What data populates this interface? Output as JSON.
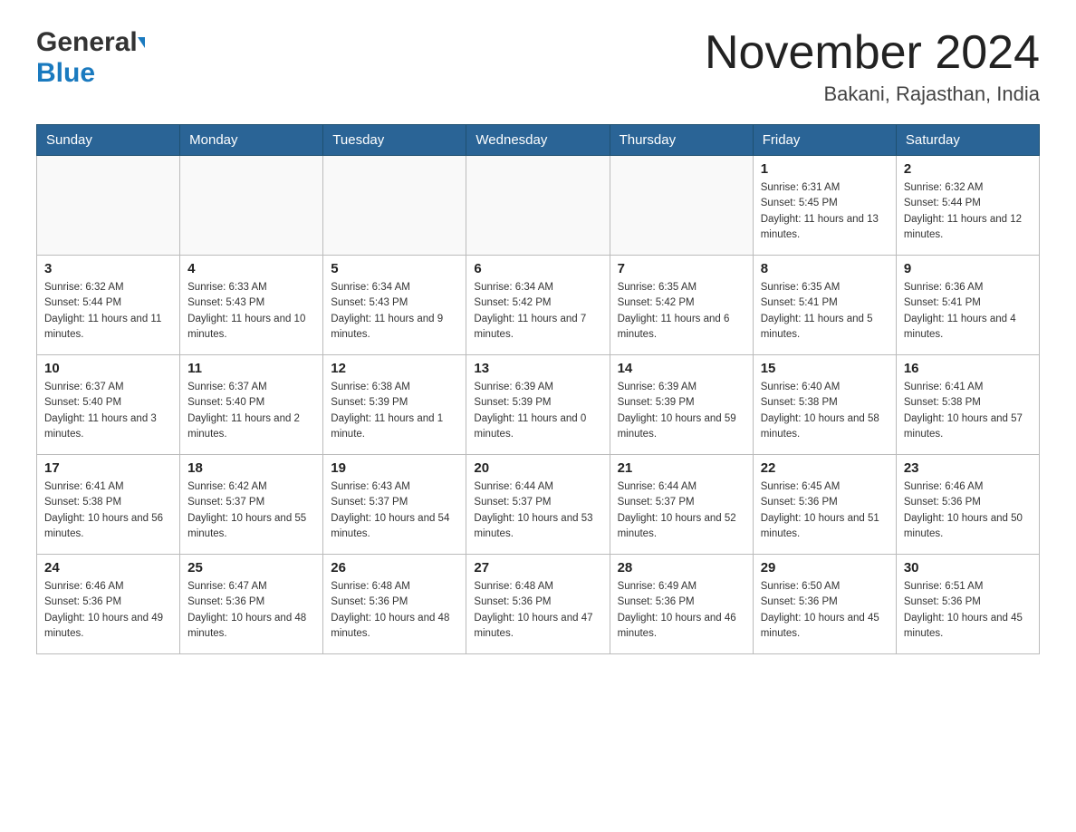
{
  "header": {
    "logo_general": "General",
    "logo_blue": "Blue",
    "month_title": "November 2024",
    "location": "Bakani, Rajasthan, India"
  },
  "weekdays": [
    "Sunday",
    "Monday",
    "Tuesday",
    "Wednesday",
    "Thursday",
    "Friday",
    "Saturday"
  ],
  "weeks": [
    [
      {
        "day": "",
        "sunrise": "",
        "sunset": "",
        "daylight": ""
      },
      {
        "day": "",
        "sunrise": "",
        "sunset": "",
        "daylight": ""
      },
      {
        "day": "",
        "sunrise": "",
        "sunset": "",
        "daylight": ""
      },
      {
        "day": "",
        "sunrise": "",
        "sunset": "",
        "daylight": ""
      },
      {
        "day": "",
        "sunrise": "",
        "sunset": "",
        "daylight": ""
      },
      {
        "day": "1",
        "sunrise": "Sunrise: 6:31 AM",
        "sunset": "Sunset: 5:45 PM",
        "daylight": "Daylight: 11 hours and 13 minutes."
      },
      {
        "day": "2",
        "sunrise": "Sunrise: 6:32 AM",
        "sunset": "Sunset: 5:44 PM",
        "daylight": "Daylight: 11 hours and 12 minutes."
      }
    ],
    [
      {
        "day": "3",
        "sunrise": "Sunrise: 6:32 AM",
        "sunset": "Sunset: 5:44 PM",
        "daylight": "Daylight: 11 hours and 11 minutes."
      },
      {
        "day": "4",
        "sunrise": "Sunrise: 6:33 AM",
        "sunset": "Sunset: 5:43 PM",
        "daylight": "Daylight: 11 hours and 10 minutes."
      },
      {
        "day": "5",
        "sunrise": "Sunrise: 6:34 AM",
        "sunset": "Sunset: 5:43 PM",
        "daylight": "Daylight: 11 hours and 9 minutes."
      },
      {
        "day": "6",
        "sunrise": "Sunrise: 6:34 AM",
        "sunset": "Sunset: 5:42 PM",
        "daylight": "Daylight: 11 hours and 7 minutes."
      },
      {
        "day": "7",
        "sunrise": "Sunrise: 6:35 AM",
        "sunset": "Sunset: 5:42 PM",
        "daylight": "Daylight: 11 hours and 6 minutes."
      },
      {
        "day": "8",
        "sunrise": "Sunrise: 6:35 AM",
        "sunset": "Sunset: 5:41 PM",
        "daylight": "Daylight: 11 hours and 5 minutes."
      },
      {
        "day": "9",
        "sunrise": "Sunrise: 6:36 AM",
        "sunset": "Sunset: 5:41 PM",
        "daylight": "Daylight: 11 hours and 4 minutes."
      }
    ],
    [
      {
        "day": "10",
        "sunrise": "Sunrise: 6:37 AM",
        "sunset": "Sunset: 5:40 PM",
        "daylight": "Daylight: 11 hours and 3 minutes."
      },
      {
        "day": "11",
        "sunrise": "Sunrise: 6:37 AM",
        "sunset": "Sunset: 5:40 PM",
        "daylight": "Daylight: 11 hours and 2 minutes."
      },
      {
        "day": "12",
        "sunrise": "Sunrise: 6:38 AM",
        "sunset": "Sunset: 5:39 PM",
        "daylight": "Daylight: 11 hours and 1 minute."
      },
      {
        "day": "13",
        "sunrise": "Sunrise: 6:39 AM",
        "sunset": "Sunset: 5:39 PM",
        "daylight": "Daylight: 11 hours and 0 minutes."
      },
      {
        "day": "14",
        "sunrise": "Sunrise: 6:39 AM",
        "sunset": "Sunset: 5:39 PM",
        "daylight": "Daylight: 10 hours and 59 minutes."
      },
      {
        "day": "15",
        "sunrise": "Sunrise: 6:40 AM",
        "sunset": "Sunset: 5:38 PM",
        "daylight": "Daylight: 10 hours and 58 minutes."
      },
      {
        "day": "16",
        "sunrise": "Sunrise: 6:41 AM",
        "sunset": "Sunset: 5:38 PM",
        "daylight": "Daylight: 10 hours and 57 minutes."
      }
    ],
    [
      {
        "day": "17",
        "sunrise": "Sunrise: 6:41 AM",
        "sunset": "Sunset: 5:38 PM",
        "daylight": "Daylight: 10 hours and 56 minutes."
      },
      {
        "day": "18",
        "sunrise": "Sunrise: 6:42 AM",
        "sunset": "Sunset: 5:37 PM",
        "daylight": "Daylight: 10 hours and 55 minutes."
      },
      {
        "day": "19",
        "sunrise": "Sunrise: 6:43 AM",
        "sunset": "Sunset: 5:37 PM",
        "daylight": "Daylight: 10 hours and 54 minutes."
      },
      {
        "day": "20",
        "sunrise": "Sunrise: 6:44 AM",
        "sunset": "Sunset: 5:37 PM",
        "daylight": "Daylight: 10 hours and 53 minutes."
      },
      {
        "day": "21",
        "sunrise": "Sunrise: 6:44 AM",
        "sunset": "Sunset: 5:37 PM",
        "daylight": "Daylight: 10 hours and 52 minutes."
      },
      {
        "day": "22",
        "sunrise": "Sunrise: 6:45 AM",
        "sunset": "Sunset: 5:36 PM",
        "daylight": "Daylight: 10 hours and 51 minutes."
      },
      {
        "day": "23",
        "sunrise": "Sunrise: 6:46 AM",
        "sunset": "Sunset: 5:36 PM",
        "daylight": "Daylight: 10 hours and 50 minutes."
      }
    ],
    [
      {
        "day": "24",
        "sunrise": "Sunrise: 6:46 AM",
        "sunset": "Sunset: 5:36 PM",
        "daylight": "Daylight: 10 hours and 49 minutes."
      },
      {
        "day": "25",
        "sunrise": "Sunrise: 6:47 AM",
        "sunset": "Sunset: 5:36 PM",
        "daylight": "Daylight: 10 hours and 48 minutes."
      },
      {
        "day": "26",
        "sunrise": "Sunrise: 6:48 AM",
        "sunset": "Sunset: 5:36 PM",
        "daylight": "Daylight: 10 hours and 48 minutes."
      },
      {
        "day": "27",
        "sunrise": "Sunrise: 6:48 AM",
        "sunset": "Sunset: 5:36 PM",
        "daylight": "Daylight: 10 hours and 47 minutes."
      },
      {
        "day": "28",
        "sunrise": "Sunrise: 6:49 AM",
        "sunset": "Sunset: 5:36 PM",
        "daylight": "Daylight: 10 hours and 46 minutes."
      },
      {
        "day": "29",
        "sunrise": "Sunrise: 6:50 AM",
        "sunset": "Sunset: 5:36 PM",
        "daylight": "Daylight: 10 hours and 45 minutes."
      },
      {
        "day": "30",
        "sunrise": "Sunrise: 6:51 AM",
        "sunset": "Sunset: 5:36 PM",
        "daylight": "Daylight: 10 hours and 45 minutes."
      }
    ]
  ]
}
